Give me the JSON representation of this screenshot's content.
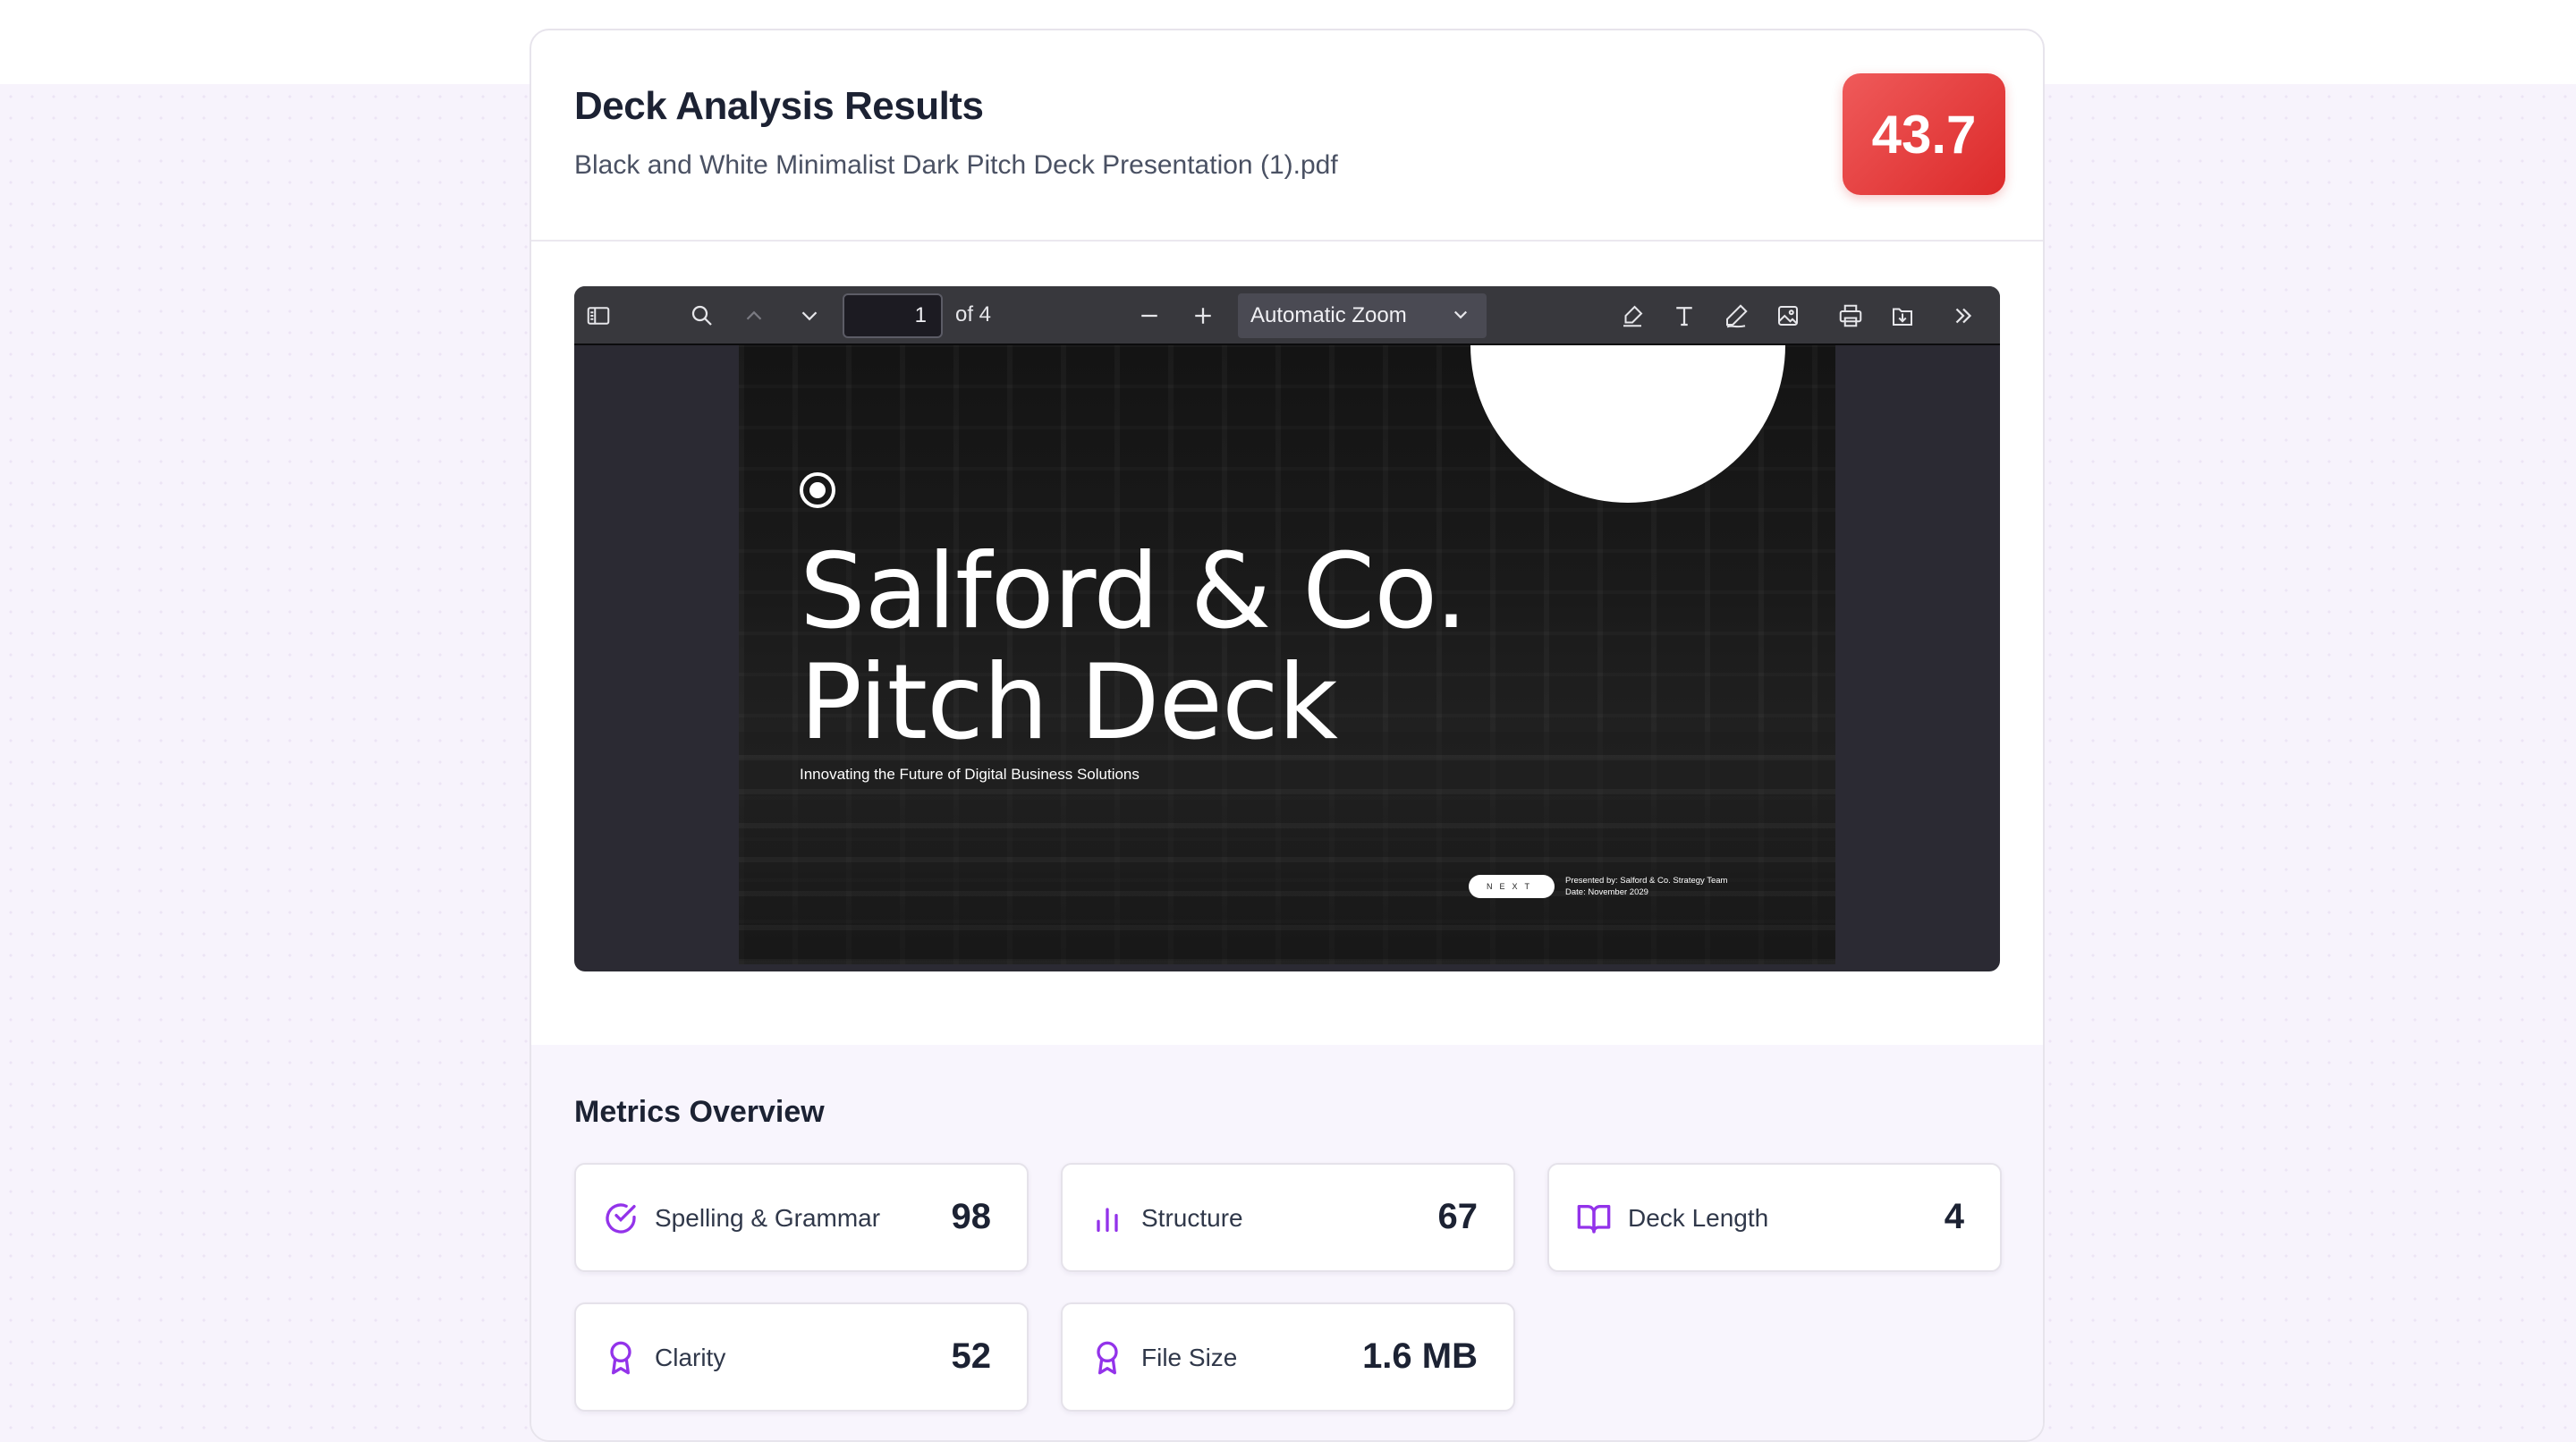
{
  "header": {
    "title": "Deck Analysis Results",
    "filename": "Black and White Minimalist Dark Pitch Deck Presentation (1).pdf",
    "score": "43.7"
  },
  "viewer": {
    "page_number": "1",
    "page_of": "of 4",
    "zoom": "Automatic Zoom",
    "icons": [
      "sidebar-toggle-icon",
      "search-icon",
      "previous-page-icon",
      "next-page-icon",
      "zoom-out-icon",
      "zoom-in-icon",
      "highlight-icon",
      "text-icon",
      "draw-icon",
      "image-icon",
      "print-icon",
      "save-icon",
      "tools-icon"
    ]
  },
  "slide": {
    "title": "Salford & Co.\nPitch Deck",
    "tagline": "Innovating the Future of Digital Business Solutions",
    "next_label": "NEXT",
    "presented_by": "Presented by: Salford & Co. Strategy Team",
    "date": "Date: November 2029"
  },
  "metrics": {
    "title": "Metrics Overview",
    "items": [
      {
        "label": "Spelling & Grammar",
        "value": "98",
        "icon": "check-circle-icon"
      },
      {
        "label": "Structure",
        "value": "67",
        "icon": "bar-chart-icon"
      },
      {
        "label": "Deck Length",
        "value": "4",
        "icon": "book-open-icon"
      },
      {
        "label": "Clarity",
        "value": "52",
        "icon": "award-icon"
      },
      {
        "label": "File Size",
        "value": "1.6 MB",
        "icon": "award-icon"
      }
    ]
  },
  "colors": {
    "accent": "#9333ea",
    "score_badge": "#e23a3a",
    "page_bg": "#f7f3fc",
    "viewer_toolbar": "#38383d"
  }
}
